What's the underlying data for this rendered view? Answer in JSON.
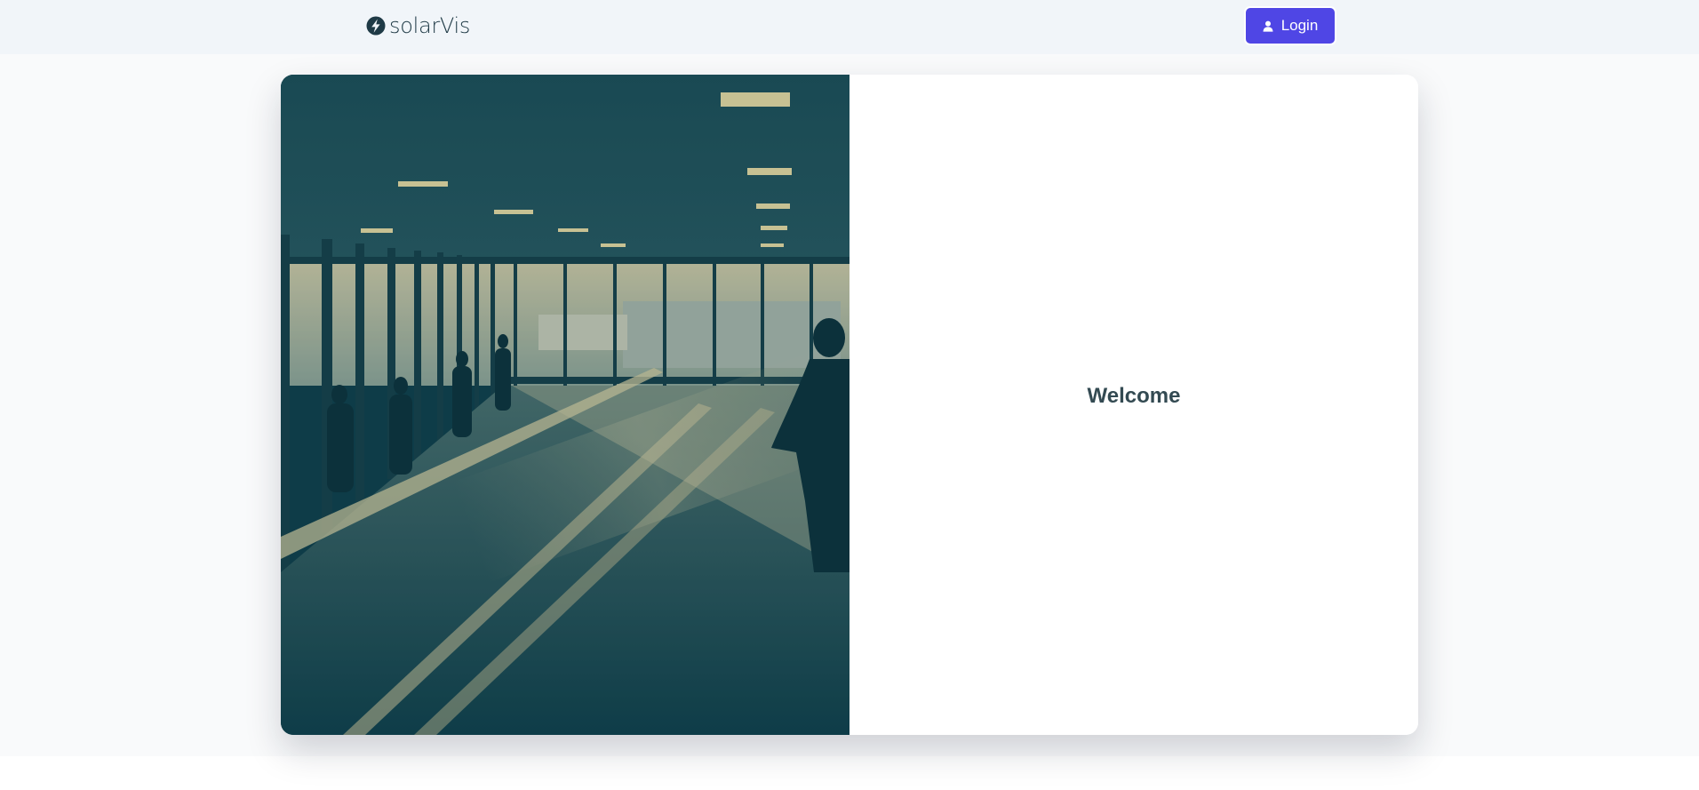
{
  "navbar": {
    "logo": {
      "text": "solarVis",
      "icon": "lightning-bolt-icon"
    },
    "login_button": {
      "label": "Login",
      "icon": "user-icon"
    }
  },
  "main": {
    "hero_image": {
      "subject": "airport-walkway-photo"
    },
    "welcome": {
      "title": "Welcome"
    }
  },
  "colors": {
    "accent": "#4f46e5",
    "navbar_bg": "#f1f5f9",
    "page_bg": "#f9fafb",
    "hero_tint": "#0f3d48",
    "title_text": "#334a52"
  }
}
